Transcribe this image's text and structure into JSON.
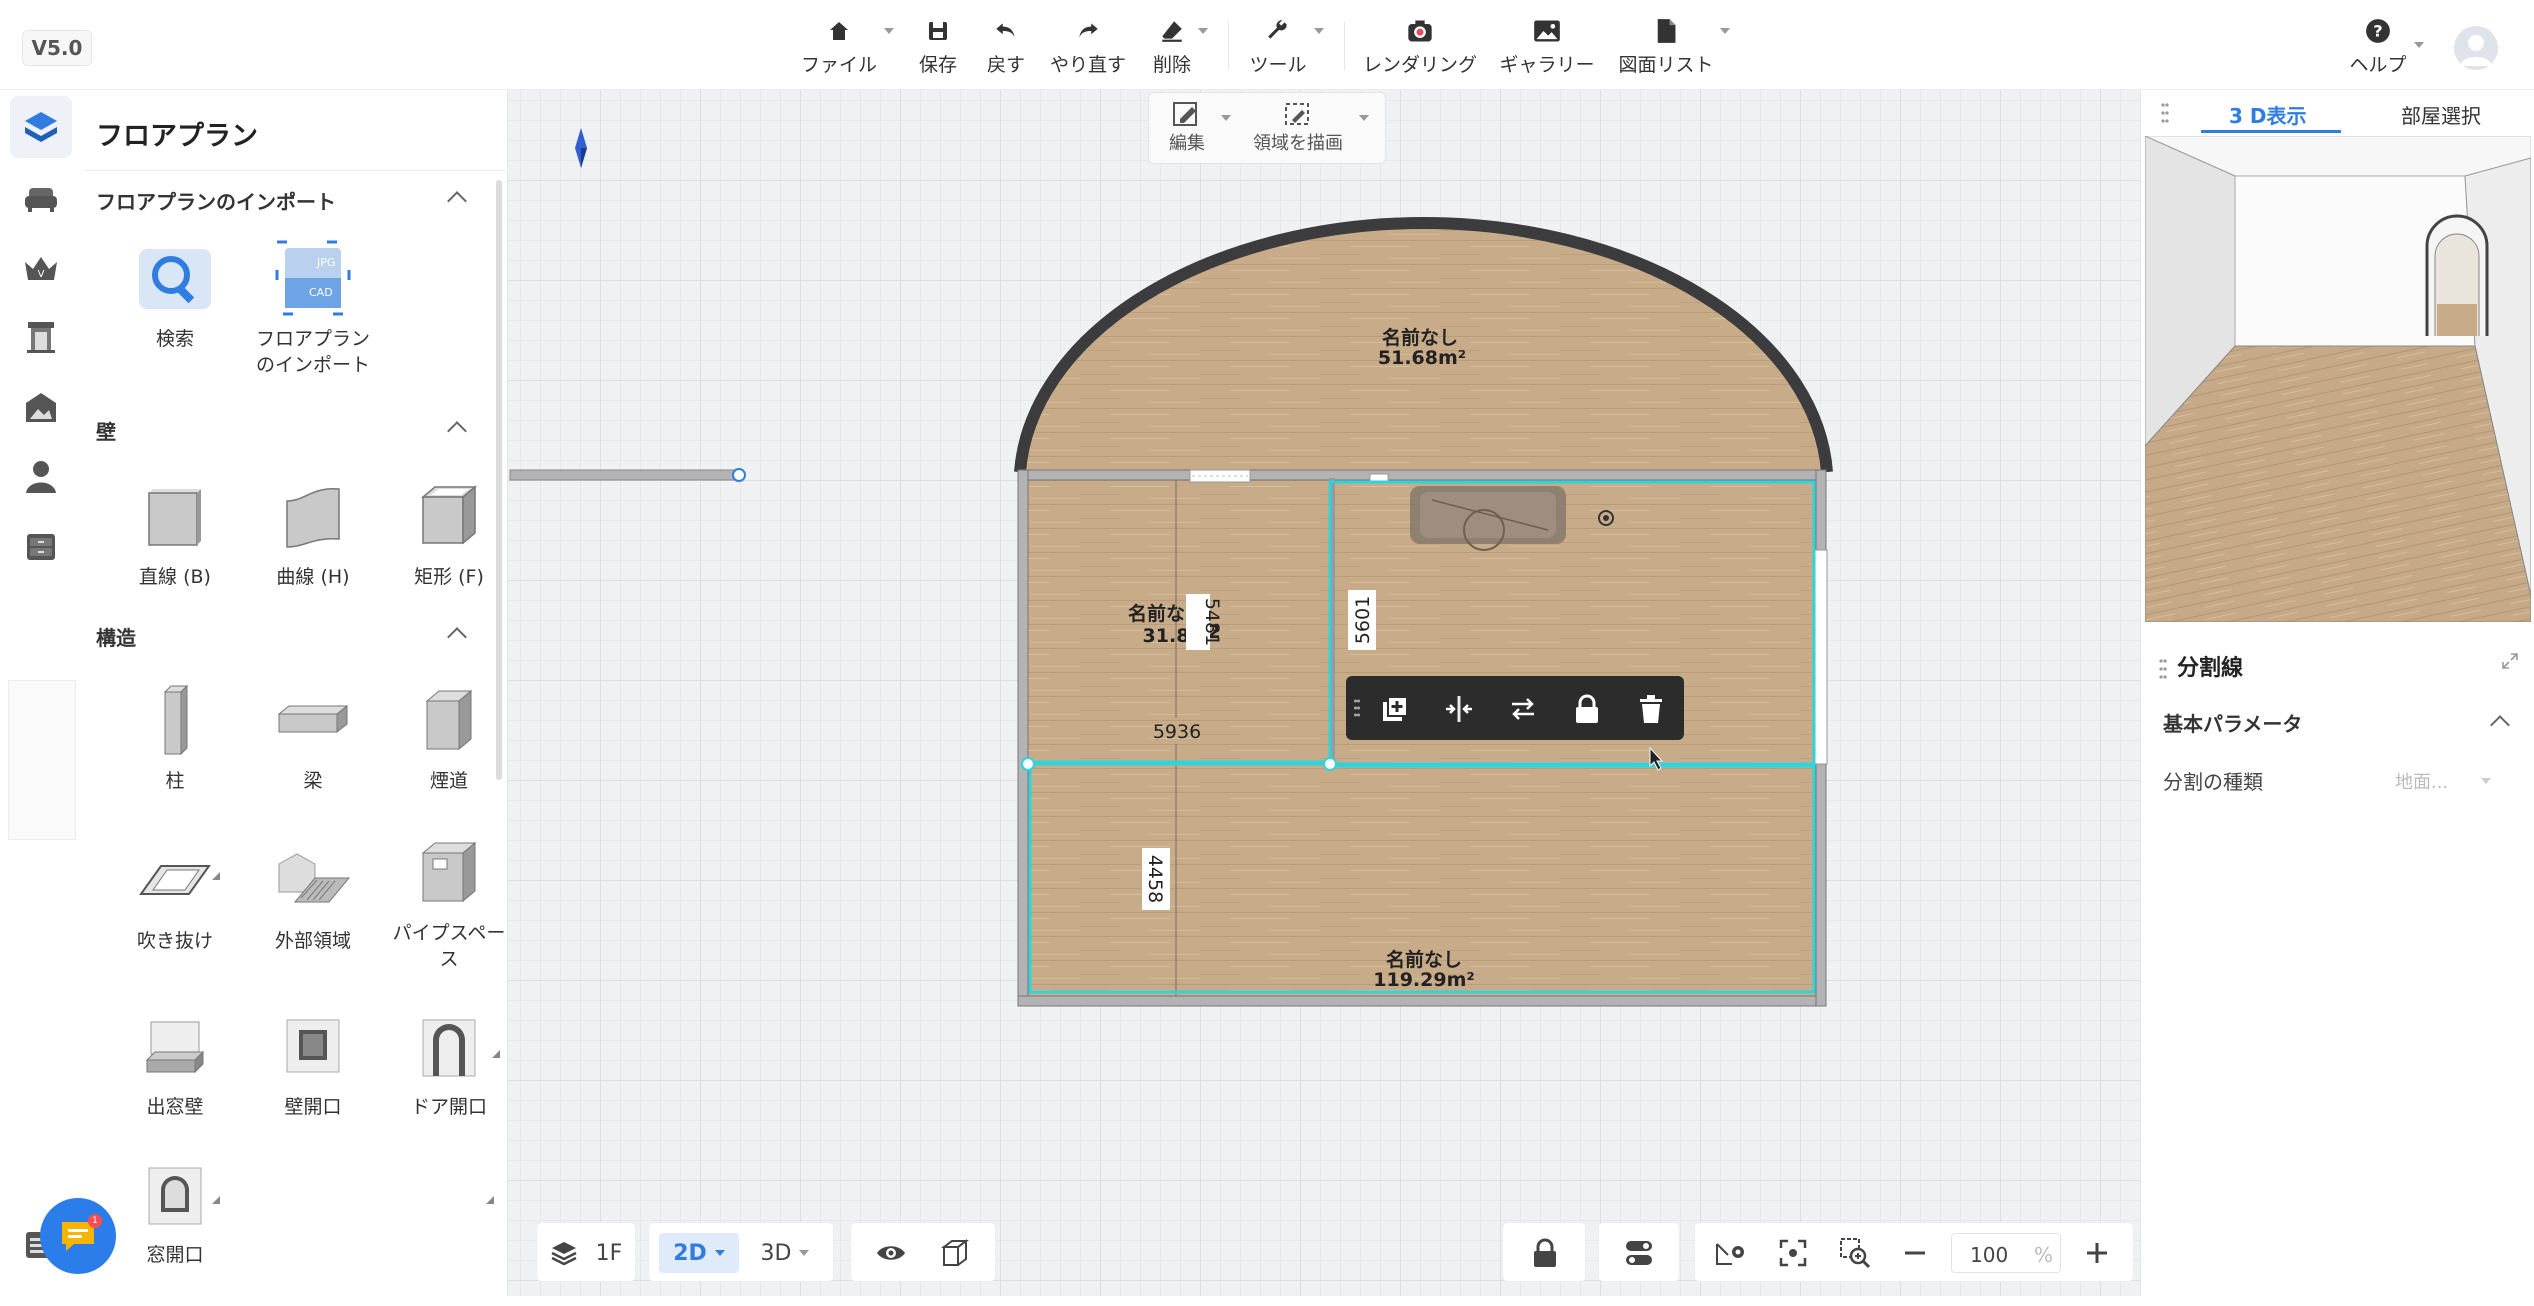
{
  "app": {
    "version": "V5.0"
  },
  "toolbar": {
    "file": "ファイル",
    "save": "保存",
    "undo": "戻す",
    "redo": "やり直す",
    "delete": "削除",
    "tools": "ツール",
    "render": "レンダリング",
    "gallery": "ギャラリー",
    "drawings": "図面リスト",
    "help": "ヘルプ"
  },
  "left_panel": {
    "title": "フロアプラン",
    "sections": [
      {
        "title": "フロアプランのインポート",
        "items": [
          "検索",
          "フロアプラン\nのインポート"
        ]
      },
      {
        "title": "壁",
        "items": [
          "直線 (B)",
          "曲線 (H)",
          "矩形 (F)"
        ]
      },
      {
        "title": "構造",
        "items": [
          "柱",
          "梁",
          "煙道",
          "吹き抜け",
          "外部領域",
          "パイプスペース",
          "出窓壁",
          "壁開口",
          "ドア開口",
          "窓開口"
        ]
      }
    ],
    "import_thumb_text": [
      "JPG",
      "CAD"
    ]
  },
  "canvas": {
    "float_toolbar": {
      "edit": "編集",
      "draw_area": "領域を描画"
    },
    "rooms": [
      {
        "name": "名前なし",
        "area": "51.68m²"
      },
      {
        "name": "名前なし",
        "area": "31.8"
      },
      {
        "name": "名前なし",
        "area": "119.29m²"
      }
    ],
    "room_fragment": "2",
    "dimensions": [
      "5481",
      "5601",
      "5936",
      "4458"
    ]
  },
  "right_panel": {
    "tabs": [
      "3 D表示",
      "部屋選択"
    ],
    "active_tab": "3 D表示",
    "prop_title": "分割線",
    "section": "基本パラメータ",
    "row_label": "分割の種類",
    "row_value": "地面..."
  },
  "bottom": {
    "floor": "1F",
    "view_2d": "2D",
    "view_3d": "3D",
    "zoom": "100",
    "zoom_unit": "%"
  },
  "chat": {
    "badge": "1"
  },
  "colors": {
    "accent": "#2f7de1",
    "selection": "#2fd3dc",
    "wall": "#3c3c3e",
    "floor": "#c9ad8b"
  }
}
